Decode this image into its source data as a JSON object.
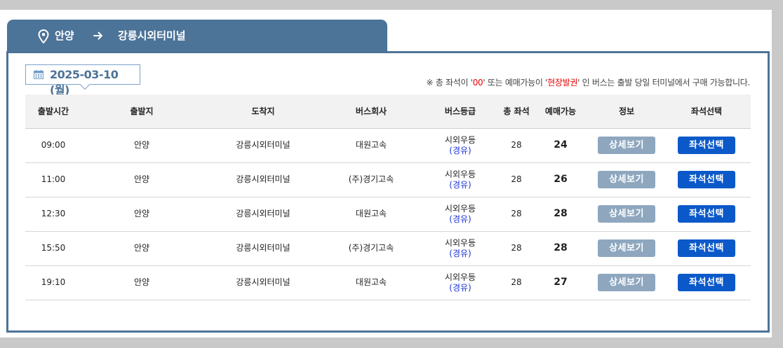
{
  "route": {
    "departure": "안양",
    "arrival": "강릉시외터미널",
    "icons": {
      "location": "map-pin-icon",
      "arrow": "arrow-right-icon"
    }
  },
  "date": {
    "value": "2025-03-10 (월)",
    "icon": "calendar-icon"
  },
  "notice": {
    "prefix": "※ 총 좌석이 '",
    "zero": "00",
    "middle": "' 또는 예매가능이 '",
    "onsite": "현장발권",
    "suffix": "' 인 버스는 출발 당일 터미널에서 구매 가능합니다."
  },
  "table": {
    "headers": [
      "출발시간",
      "출발지",
      "도착지",
      "버스회사",
      "버스등급",
      "총 좌석",
      "예매가능",
      "정보",
      "좌석선택"
    ],
    "rows": [
      {
        "time": "09:00",
        "from": "안양",
        "to": "강릉시외터미널",
        "company": "대원고속",
        "grade": "시외우등",
        "via": "(경유)",
        "total": "28",
        "available": "24",
        "detail": "상세보기",
        "select": "좌석선택"
      },
      {
        "time": "11:00",
        "from": "안양",
        "to": "강릉시외터미널",
        "company": "(주)경기고속",
        "grade": "시외우등",
        "via": "(경유)",
        "total": "28",
        "available": "26",
        "detail": "상세보기",
        "select": "좌석선택"
      },
      {
        "time": "12:30",
        "from": "안양",
        "to": "강릉시외터미널",
        "company": "대원고속",
        "grade": "시외우등",
        "via": "(경유)",
        "total": "28",
        "available": "28",
        "detail": "상세보기",
        "select": "좌석선택"
      },
      {
        "time": "15:50",
        "from": "안양",
        "to": "강릉시외터미널",
        "company": "(주)경기고속",
        "grade": "시외우등",
        "via": "(경유)",
        "total": "28",
        "available": "28",
        "detail": "상세보기",
        "select": "좌석선택"
      },
      {
        "time": "19:10",
        "from": "안양",
        "to": "강릉시외터미널",
        "company": "대원고속",
        "grade": "시외우등",
        "via": "(경유)",
        "total": "28",
        "available": "27",
        "detail": "상세보기",
        "select": "좌석선택"
      }
    ]
  },
  "colors": {
    "header_bar": "#4c7398",
    "detail_button": "#8ea7bf",
    "select_button": "#0b59c9",
    "via_text": "#1a33d6",
    "notice_highlight": "#e60000"
  }
}
